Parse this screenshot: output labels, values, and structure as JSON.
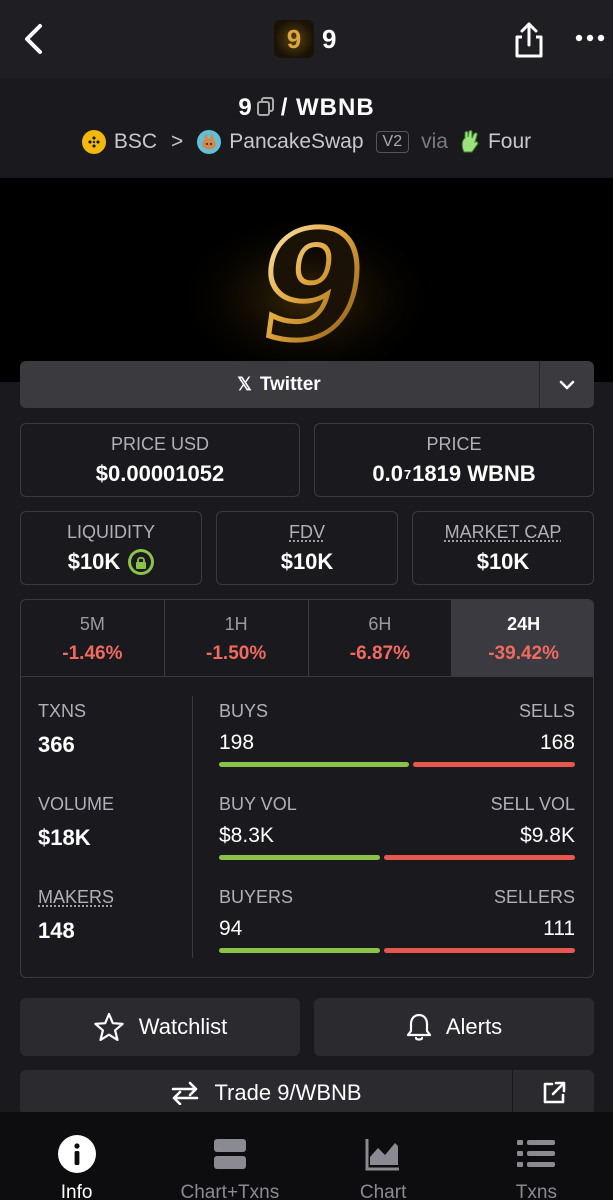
{
  "header": {
    "title": "9",
    "logo_text": "9"
  },
  "pair": {
    "base": "9",
    "quote": "/ WBNB",
    "chain": "BSC",
    "dex": "PancakeSwap",
    "version": "V2",
    "via": "via",
    "launchpad": "Four"
  },
  "banner": {
    "glyph": "9"
  },
  "social": {
    "twitter_label": "Twitter"
  },
  "prices": {
    "price_usd_label": "PRICE USD",
    "price_usd_value": "$0.00001052",
    "price_label": "PRICE",
    "price_prefix": "0.0",
    "price_sub": "7",
    "price_suffix": "1819 WBNB"
  },
  "metrics": {
    "liquidity_label": "LIQUIDITY",
    "liquidity_value": "$10K",
    "fdv_label": "FDV",
    "fdv_value": "$10K",
    "mcap_label": "MARKET CAP",
    "mcap_value": "$10K"
  },
  "tabs": [
    {
      "label": "5M",
      "change": "-1.46%"
    },
    {
      "label": "1H",
      "change": "-1.50%"
    },
    {
      "label": "6H",
      "change": "-6.87%"
    },
    {
      "label": "24H",
      "change": "-39.42%"
    }
  ],
  "stats": {
    "txns_label": "TXNS",
    "txns_value": "366",
    "volume_label": "VOLUME",
    "volume_value": "$18K",
    "makers_label": "MAKERS",
    "makers_value": "148",
    "buys_label": "BUYS",
    "buys_value": "198",
    "sells_label": "SELLS",
    "sells_value": "168",
    "buy_vol_label": "BUY VOL",
    "buy_vol_value": "$8.3K",
    "sell_vol_label": "SELL VOL",
    "sell_vol_value": "$9.8K",
    "buyers_label": "BUYERS",
    "buyers_value": "94",
    "sellers_label": "SELLERS",
    "sellers_value": "111"
  },
  "actions": {
    "watchlist": "Watchlist",
    "alerts": "Alerts",
    "trade": "Trade 9/WBNB"
  },
  "nav": [
    {
      "label": "Info",
      "icon": "info-icon"
    },
    {
      "label": "Chart+Txns",
      "icon": "chart-txns-icon"
    },
    {
      "label": "Chart",
      "icon": "chart-icon"
    },
    {
      "label": "Txns",
      "icon": "list-icon"
    }
  ],
  "colors": {
    "positive": "#8bc34a",
    "negative": "#e8574d",
    "change_text": "#f06a60",
    "background": "#1a1a1e"
  }
}
